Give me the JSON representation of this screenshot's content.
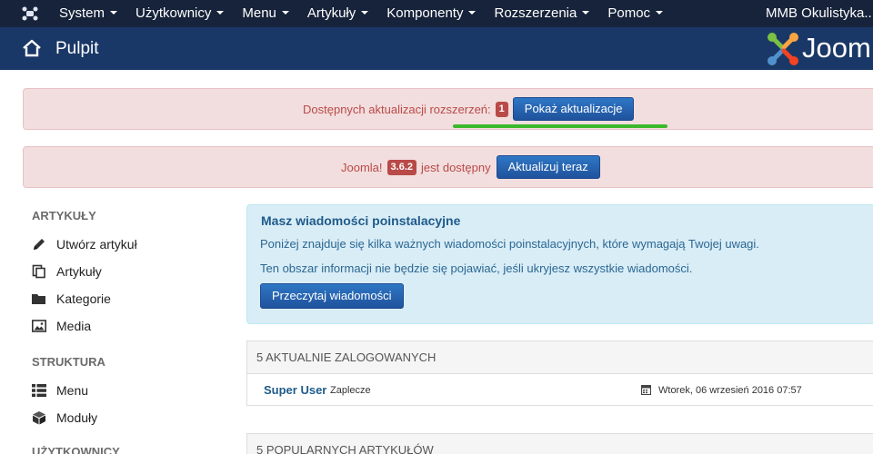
{
  "navbar": {
    "menu": [
      "System",
      "Użytkownicy",
      "Menu",
      "Artykuły",
      "Komponenty",
      "Rozszerzenia",
      "Pomoc"
    ],
    "site_name": "MMB Okulistyka..."
  },
  "header": {
    "title": "Pulpit",
    "brand_text": "Joom"
  },
  "alerts": {
    "extensions": {
      "text": "Dostępnych aktualizacji rozszerzeń:",
      "count": "1",
      "button": "Pokaż aktualizacje"
    },
    "joomla": {
      "prefix": "Joomla!",
      "version": "3.6.2",
      "suffix": "jest dostępny",
      "button": "Aktualizuj teraz"
    }
  },
  "sidebar": {
    "articles_heading": "ARTYKUŁY",
    "articles": [
      {
        "label": "Utwórz artykuł",
        "icon": "pencil-icon"
      },
      {
        "label": "Artykuły",
        "icon": "copy-icon"
      },
      {
        "label": "Kategorie",
        "icon": "folder-icon"
      },
      {
        "label": "Media",
        "icon": "image-icon"
      }
    ],
    "structure_heading": "STRUKTURA",
    "structure": [
      {
        "label": "Menu",
        "icon": "list-icon"
      },
      {
        "label": "Moduły",
        "icon": "cube-icon"
      }
    ],
    "users_heading": "UŻYTKOWNICY"
  },
  "postinstall": {
    "title": "Masz wiadomości poinstalacyjne",
    "line1": "Poniżej znajduje się kilka ważnych wiadomości poinstalacyjnych, które wymagają Twojej uwagi.",
    "line2": "Ten obszar informacji nie będzie się pojawiać, jeśli ukryjesz wszystkie wiadomości.",
    "button": "Przeczytaj wiadomości"
  },
  "logged": {
    "heading": "5 AKTUALNIE ZALOGOWANYCH",
    "user": "Super User",
    "context": "Zaplecze",
    "date": "Wtorek, 06 wrzesień 2016 07:57"
  },
  "popular": {
    "heading": "5 POPULARNYCH ARTYKUŁÓW"
  },
  "colors": {
    "navbar": "#17233a",
    "header": "#1a3867",
    "alert_bg": "#f2dede",
    "info_bg": "#d9edf7",
    "button": "#2a69b8",
    "highlight": "#3bb82c"
  }
}
